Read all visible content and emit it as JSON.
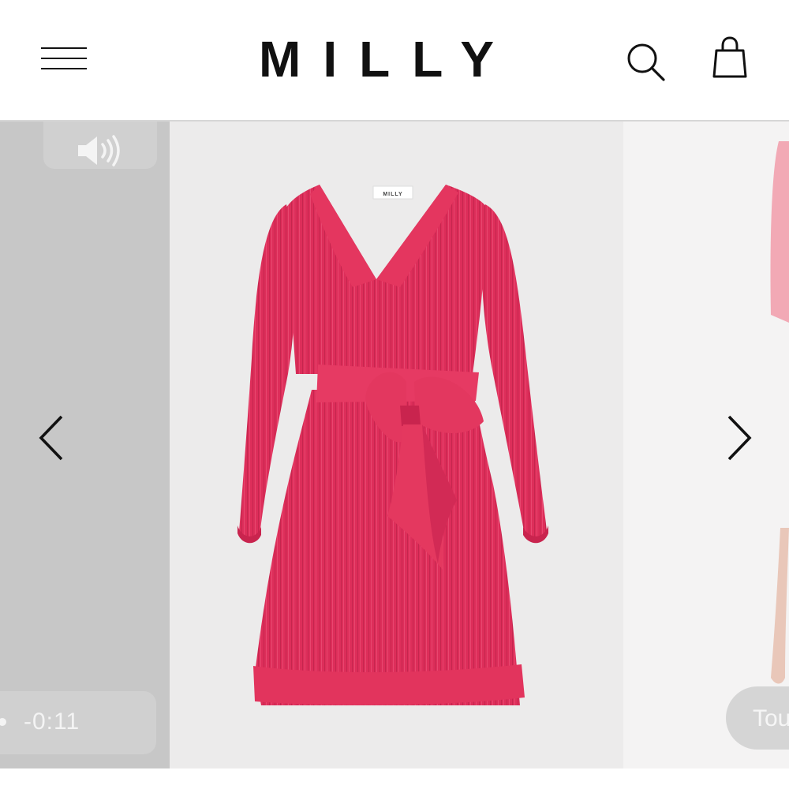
{
  "header": {
    "brand": "MILLY",
    "menu_icon": "hamburger-menu-icon",
    "search_icon": "search-icon",
    "bag_icon": "shopping-bag-icon"
  },
  "gallery": {
    "prev_slide": {
      "sound_icon": "speaker-volume-icon",
      "time_remaining": "-0:11"
    },
    "main_slide": {
      "image": "pink-pleated-wrap-dress",
      "dress_color": "#e0325e",
      "label_text": "MILLY"
    },
    "next_slide": {
      "touch_label": "Tou"
    },
    "prev_arrow_icon": "chevron-left-icon",
    "next_arrow_icon": "chevron-right-icon"
  },
  "colors": {
    "header_bg": "#ffffff",
    "text": "#111111",
    "prev_panel_bg": "#c7c7c7",
    "main_panel_bg": "#ecebeb",
    "next_panel_bg": "#f4f3f3"
  }
}
